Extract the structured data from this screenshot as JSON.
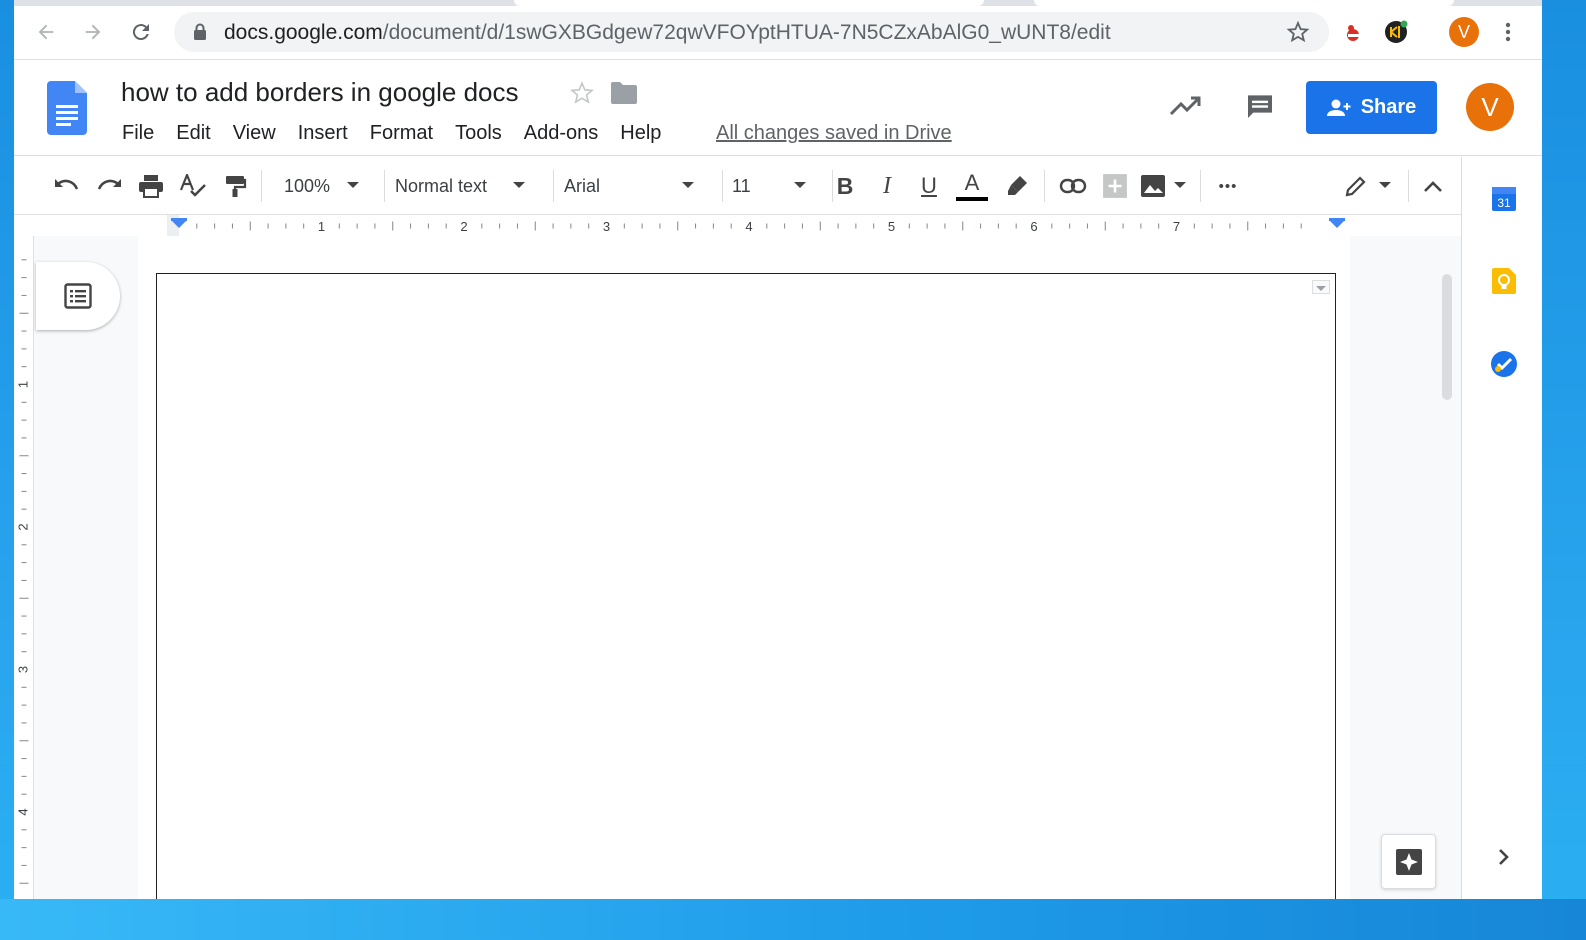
{
  "browser": {
    "url_host": "docs.google.com",
    "url_path": "/document/d/1swGXBGdgew72qwVFOYptHTUA-7N5CZxAbAlG0_wUNT8/edit",
    "profile_initial": "V"
  },
  "header": {
    "doc_title": "how to add borders in google docs",
    "menu": [
      "File",
      "Edit",
      "View",
      "Insert",
      "Format",
      "Tools",
      "Add-ons",
      "Help"
    ],
    "saved_status": "All changes saved in Drive",
    "share_label": "Share",
    "avatar_initial": "V"
  },
  "toolbar": {
    "zoom": "100%",
    "style": "Normal text",
    "font": "Arial",
    "font_size": "11",
    "bold": "B",
    "italic": "I",
    "underline": "U",
    "text_color": "A",
    "more": "•••"
  },
  "ruler": {
    "labels": [
      "1",
      "1",
      "2",
      "3",
      "4",
      "5",
      "6",
      "7"
    ]
  },
  "vertical_ruler": {
    "labels": [
      "1",
      "2",
      "3",
      "4"
    ]
  },
  "sidepanel": {
    "calendar_day": "31"
  },
  "colors": {
    "accent": "#1a73e8",
    "avatar": "#e8710a",
    "docs_blue": "#4285f4",
    "keep_yellow": "#fbbc04"
  }
}
